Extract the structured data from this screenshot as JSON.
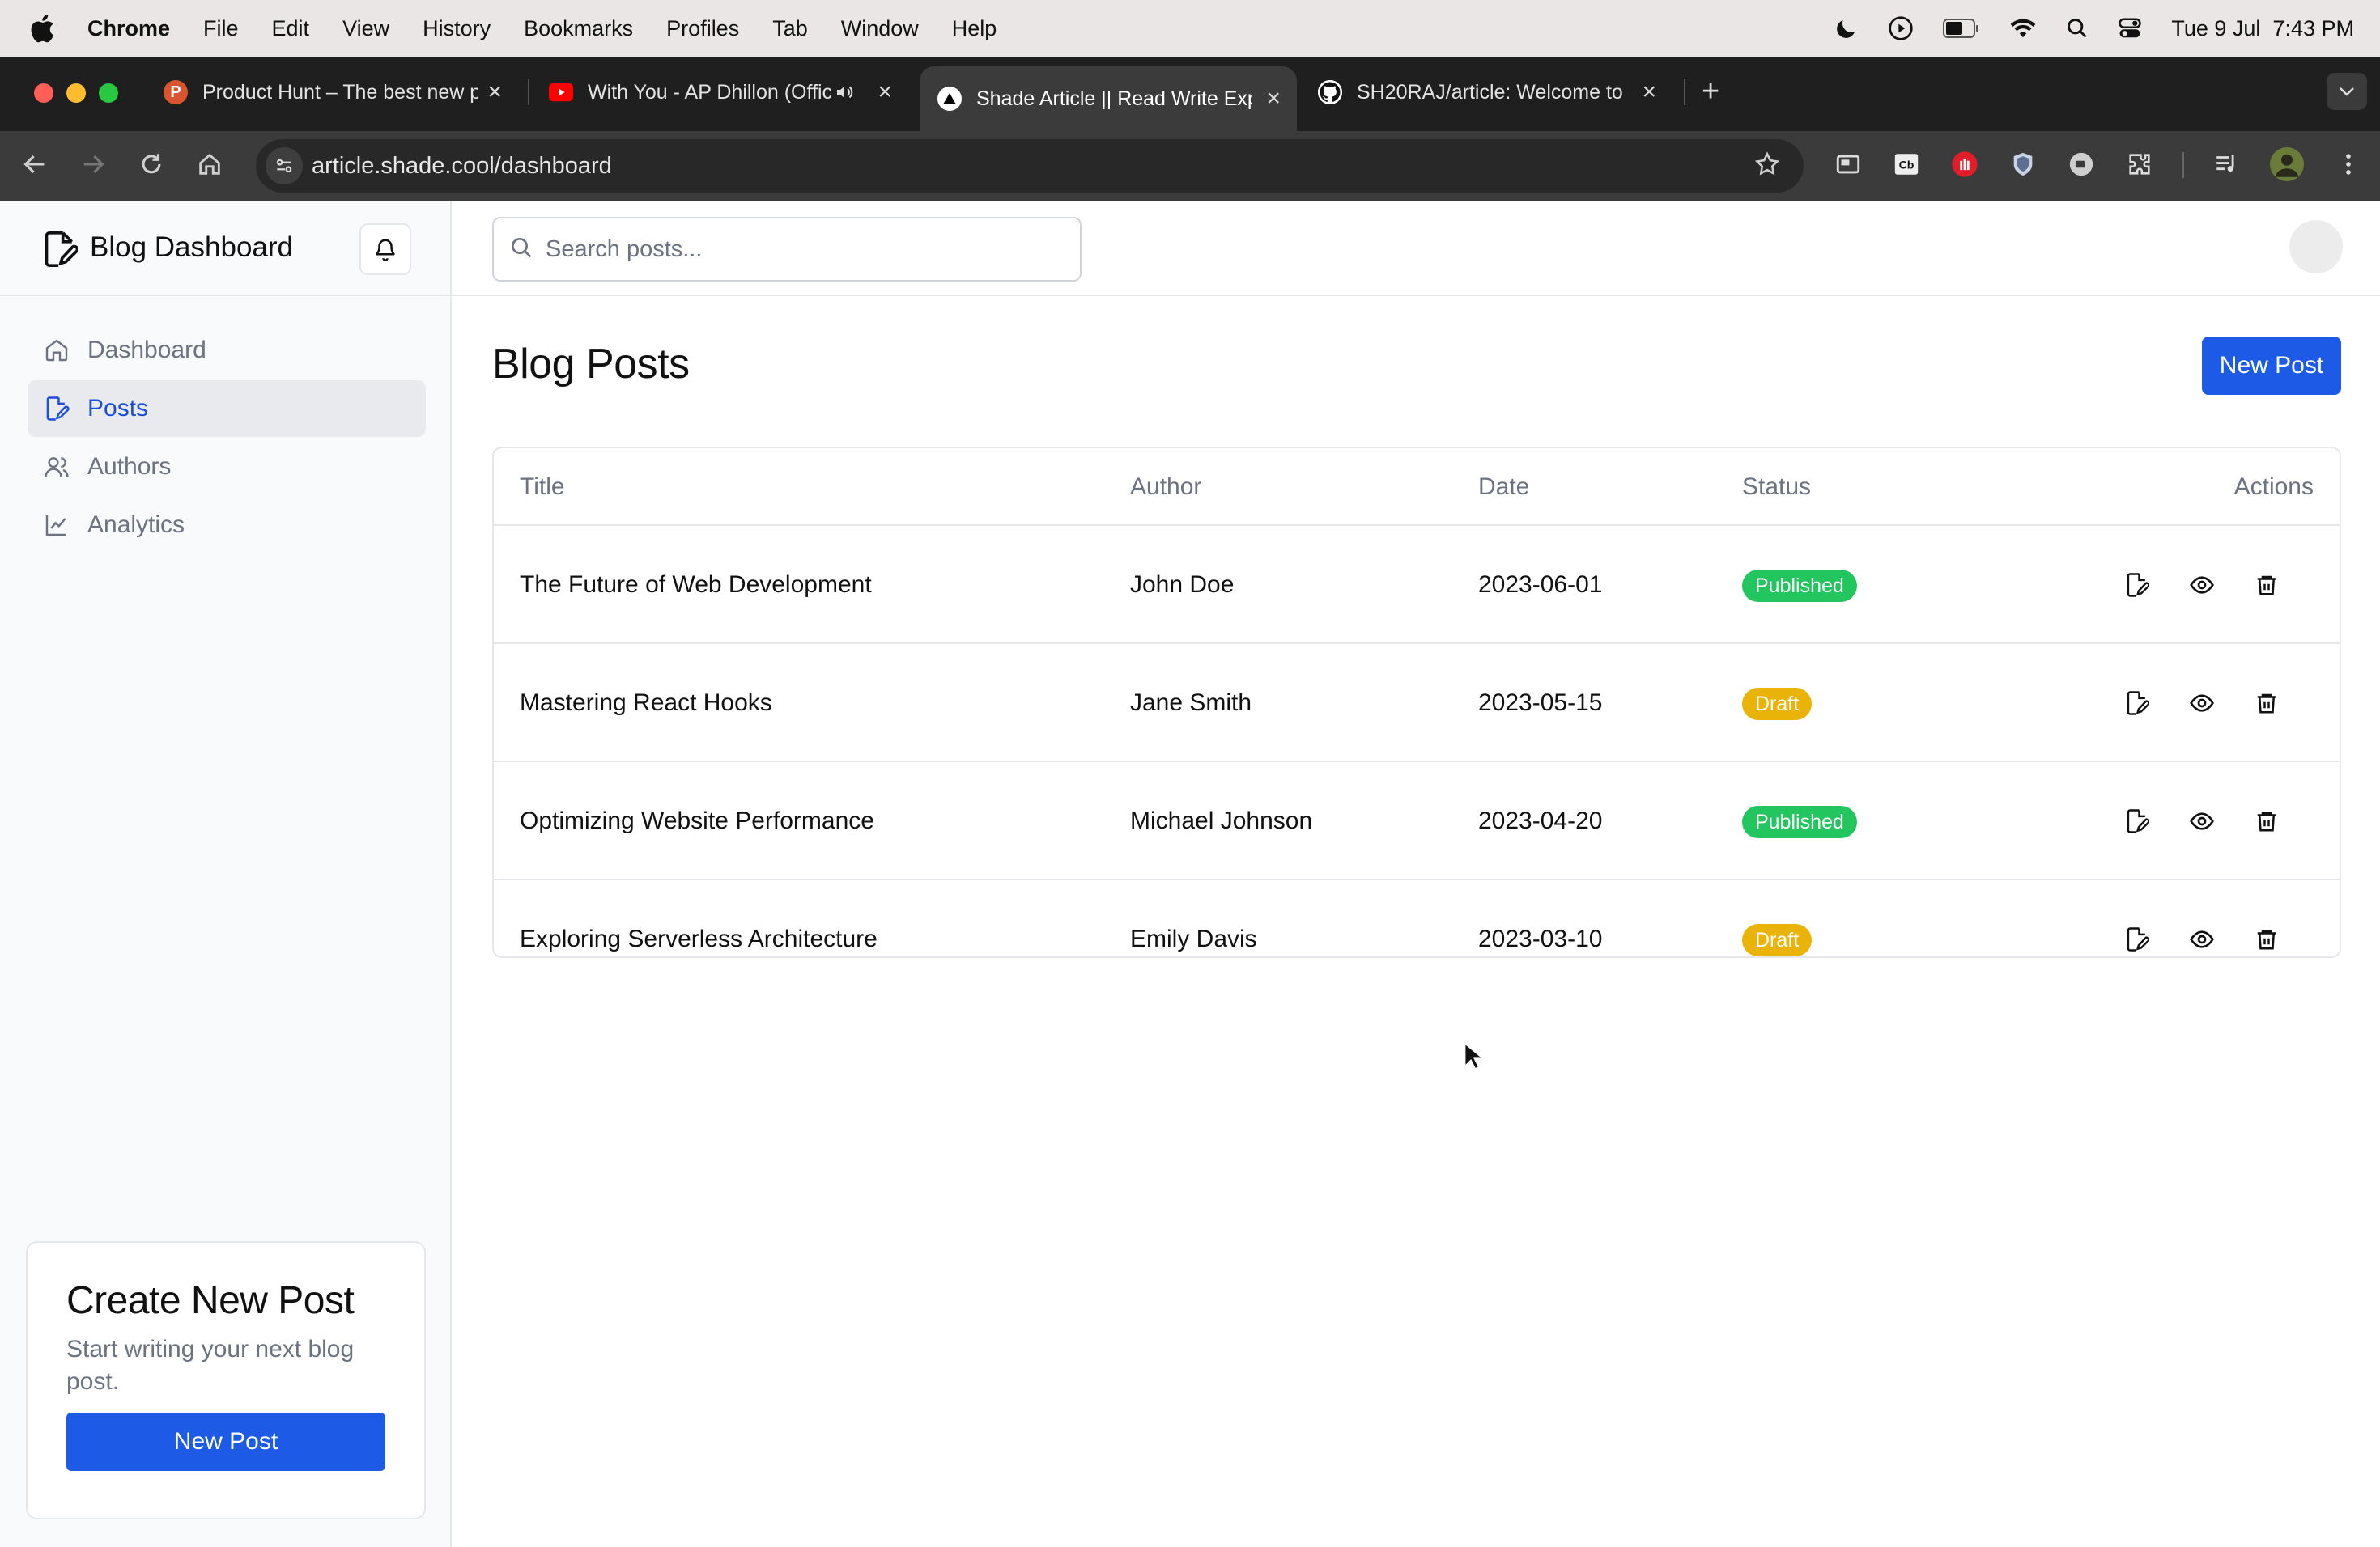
{
  "menubar": {
    "items": [
      "Chrome",
      "File",
      "Edit",
      "View",
      "History",
      "Bookmarks",
      "Profiles",
      "Tab",
      "Window",
      "Help"
    ],
    "clock": "Tue 9 Jul  7:43 PM"
  },
  "browser": {
    "tabs": [
      {
        "title": "Product Hunt – The best new products in tech",
        "favicon": "producthunt-icon",
        "color": "#da552f"
      },
      {
        "title": "With You - AP Dhillon (Official Video)",
        "favicon": "youtube-icon",
        "color": "#ff0000"
      },
      {
        "title": "Shade Article || Read Write Explore",
        "favicon": "triangle-icon",
        "color": "#ffffff"
      },
      {
        "title": "SH20RAJ/article: Welcome to",
        "favicon": "github-icon",
        "color": "#ffffff"
      }
    ],
    "url": "article.shade.cool/dashboard"
  },
  "sidebar": {
    "brand": "Blog Dashboard",
    "nav": [
      {
        "label": "Dashboard",
        "icon": "home-icon",
        "active": false
      },
      {
        "label": "Posts",
        "icon": "file-pen-icon",
        "active": true
      },
      {
        "label": "Authors",
        "icon": "users-icon",
        "active": false
      },
      {
        "label": "Analytics",
        "icon": "line-chart-icon",
        "active": false
      }
    ],
    "card": {
      "title": "Create New Post",
      "subtitle": "Start writing your next blog post.",
      "button": "New Post"
    }
  },
  "search": {
    "placeholder": "Search posts..."
  },
  "main": {
    "title": "Blog Posts",
    "new_button": "New Post",
    "table": {
      "headers": {
        "title": "Title",
        "author": "Author",
        "date": "Date",
        "status": "Status",
        "actions": "Actions"
      },
      "rows": [
        {
          "title": "The Future of Web Development",
          "author": "John Doe",
          "date": "2023-06-01",
          "status": "Published"
        },
        {
          "title": "Mastering React Hooks",
          "author": "Jane Smith",
          "date": "2023-05-15",
          "status": "Draft"
        },
        {
          "title": "Optimizing Website Performance",
          "author": "Michael Johnson",
          "date": "2023-04-20",
          "status": "Published"
        },
        {
          "title": "Exploring Serverless Architecture",
          "author": "Emily Davis",
          "date": "2023-03-10",
          "status": "Draft"
        }
      ]
    }
  },
  "colors": {
    "accent": "#1d5be6",
    "published": "#22c55e",
    "draft": "#eab308"
  }
}
